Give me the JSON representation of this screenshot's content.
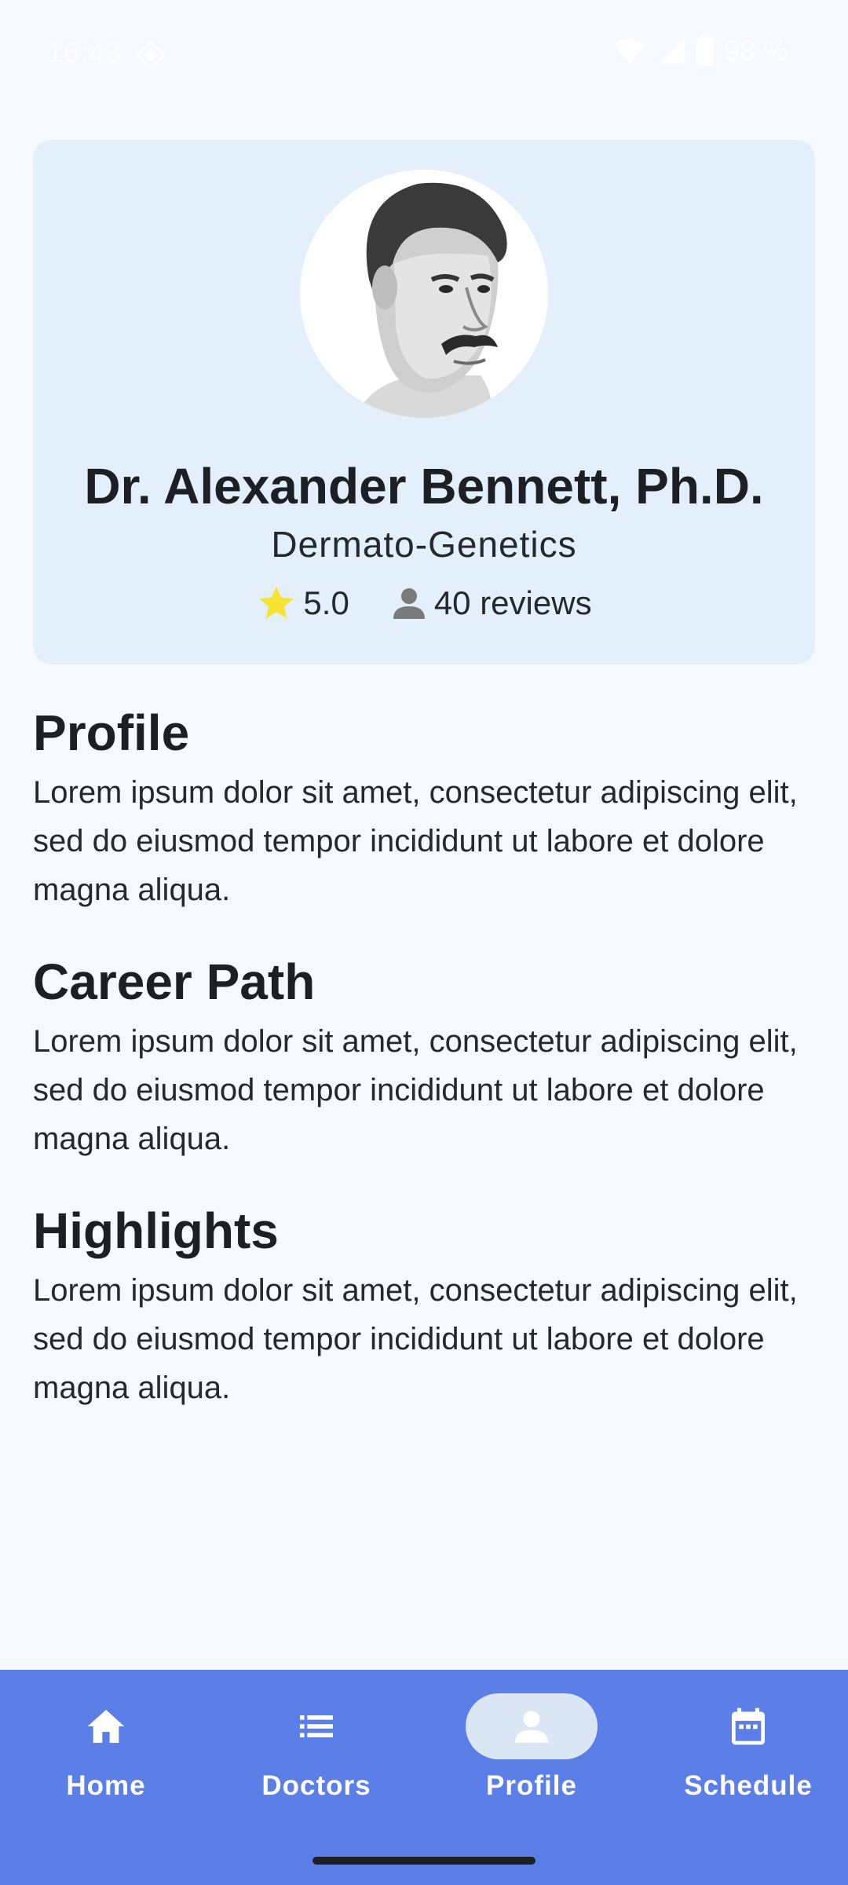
{
  "status_bar": {
    "time": "16:43",
    "battery": "98 %",
    "icons": [
      "diamond-notification-icon",
      "wifi-icon",
      "cell-signal-icon",
      "battery-icon"
    ]
  },
  "doctor": {
    "avatar": "doctor-portrait-avatar",
    "name": "Dr. Alexander Bennett, Ph.D.",
    "specialty": "Dermato-Genetics",
    "rating": "5.0",
    "reviews": "40 reviews"
  },
  "sections": [
    {
      "title": "Profile",
      "body": "Lorem ipsum dolor sit amet, consectetur adipiscing elit, sed do eiusmod tempor incididunt ut labore et dolore magna aliqua."
    },
    {
      "title": "Career Path",
      "body": "Lorem ipsum dolor sit amet, consectetur adipiscing elit, sed do eiusmod tempor incididunt ut labore et dolore magna aliqua."
    },
    {
      "title": "Highlights",
      "body": "Lorem ipsum dolor sit amet, consectetur adipiscing elit, sed do eiusmod tempor incididunt ut labore et dolore magna aliqua."
    }
  ],
  "bottom_nav": {
    "items": [
      {
        "label": "Home",
        "icon": "home-icon"
      },
      {
        "label": "Doctors",
        "icon": "list-icon"
      },
      {
        "label": "Profile",
        "icon": "person-icon",
        "selected": true
      },
      {
        "label": "Schedule",
        "icon": "calendar-icon"
      }
    ]
  },
  "colors": {
    "background": "#f6f9ff",
    "card": "#e3f0fb",
    "nav": "#5b7fe6",
    "nav_active_pill": "#dbe6f5",
    "star": "#f7e331"
  }
}
